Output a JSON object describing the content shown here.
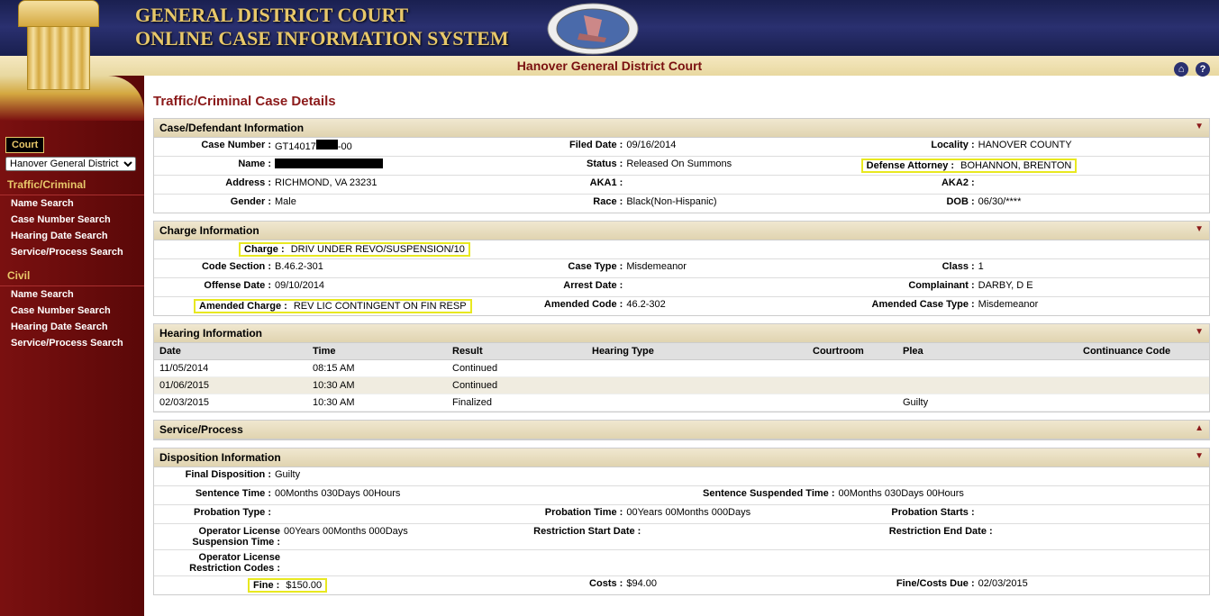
{
  "header": {
    "title_line1": "GENERAL DISTRICT COURT",
    "title_line2": "ONLINE CASE INFORMATION SYSTEM",
    "court_name": "Hanover General District Court"
  },
  "sidebar": {
    "court_label": "Court",
    "court_selected": "Hanover General District",
    "traffic_label": "Traffic/Criminal",
    "civil_label": "Civil",
    "links": {
      "name_search": "Name Search",
      "case_number_search": "Case Number Search",
      "hearing_date_search": "Hearing Date Search",
      "service_process_search": "Service/Process Search"
    }
  },
  "page_title": "Traffic/Criminal Case Details",
  "case_info": {
    "heading": "Case/Defendant Information",
    "case_number_label": "Case Number :",
    "case_number_prefix": "GT14017",
    "case_number_suffix": "-00",
    "filed_date_label": "Filed Date :",
    "filed_date": "09/16/2014",
    "locality_label": "Locality :",
    "locality": "HANOVER COUNTY",
    "name_label": "Name :",
    "status_label": "Status :",
    "status": "Released On Summons",
    "defense_attorney_label": "Defense Attorney :",
    "defense_attorney": "BOHANNON, BRENTON",
    "address_label": "Address :",
    "address": "RICHMOND, VA 23231",
    "aka1_label": "AKA1 :",
    "aka2_label": "AKA2 :",
    "gender_label": "Gender :",
    "gender": "Male",
    "race_label": "Race :",
    "race": "Black(Non-Hispanic)",
    "dob_label": "DOB :",
    "dob": "06/30/****"
  },
  "charge_info": {
    "heading": "Charge Information",
    "charge_label": "Charge :",
    "charge": "DRIV UNDER REVO/SUSPENSION/10",
    "code_section_label": "Code Section :",
    "code_section": "B.46.2-301",
    "case_type_label": "Case Type :",
    "case_type": "Misdemeanor",
    "class_label": "Class :",
    "class": "1",
    "offense_date_label": "Offense Date :",
    "offense_date": "09/10/2014",
    "arrest_date_label": "Arrest Date :",
    "complainant_label": "Complainant :",
    "complainant": "DARBY, D E",
    "amended_charge_label": "Amended Charge :",
    "amended_charge": "REV LIC CONTINGENT ON FIN RESP",
    "amended_code_label": "Amended Code :",
    "amended_code": "46.2-302",
    "amended_case_type_label": "Amended Case Type :",
    "amended_case_type": "Misdemeanor"
  },
  "hearing_info": {
    "heading": "Hearing Information",
    "columns": {
      "date": "Date",
      "time": "Time",
      "result": "Result",
      "hearing_type": "Hearing Type",
      "courtroom": "Courtroom",
      "plea": "Plea",
      "continuance": "Continuance Code"
    },
    "rows": [
      {
        "date": "11/05/2014",
        "time": "08:15 AM",
        "result": "Continued",
        "type": "",
        "courtroom": "",
        "plea": "",
        "cont": ""
      },
      {
        "date": "01/06/2015",
        "time": "10:30 AM",
        "result": "Continued",
        "type": "",
        "courtroom": "",
        "plea": "",
        "cont": ""
      },
      {
        "date": "02/03/2015",
        "time": "10:30 AM",
        "result": "Finalized",
        "type": "",
        "courtroom": "",
        "plea": "Guilty",
        "cont": ""
      }
    ]
  },
  "service_process": {
    "heading": "Service/Process"
  },
  "disposition": {
    "heading": "Disposition Information",
    "final_disposition_label": "Final Disposition :",
    "final_disposition": "Guilty",
    "sentence_time_label": "Sentence Time :",
    "sentence_time": "00Months 030Days 00Hours",
    "sentence_suspended_label": "Sentence Suspended Time :",
    "sentence_suspended": "00Months 030Days 00Hours",
    "probation_type_label": "Probation Type :",
    "probation_time_label": "Probation Time :",
    "probation_time": "00Years 00Months 000Days",
    "probation_starts_label": "Probation Starts :",
    "op_lic_susp_label": "Operator License Suspension Time :",
    "op_lic_susp": "00Years 00Months 000Days",
    "restriction_start_label": "Restriction Start Date :",
    "restriction_end_label": "Restriction End Date :",
    "op_lic_restr_label": "Operator License Restriction Codes :",
    "fine_label": "Fine :",
    "fine": "$150.00",
    "costs_label": "Costs :",
    "costs": "$94.00",
    "fine_costs_due_label": "Fine/Costs Due :",
    "fine_costs_due": "02/03/2015"
  }
}
